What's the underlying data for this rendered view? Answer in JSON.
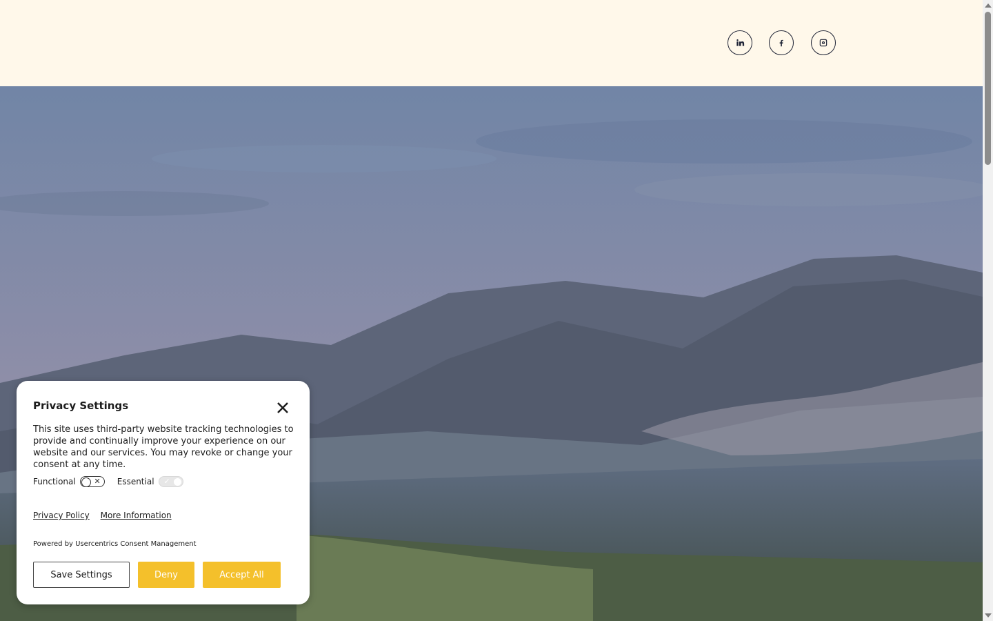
{
  "header": {
    "social": [
      {
        "name": "LinkedIn",
        "icon": "linkedin-icon"
      },
      {
        "name": "Facebook",
        "icon": "facebook-icon"
      },
      {
        "name": "Instagram",
        "icon": "instagram-icon"
      }
    ]
  },
  "consent": {
    "title": "Privacy Settings",
    "description": "This site uses third-party website tracking technologies to provide and continually improve your experience on our website and our services. You may revoke or change your consent at any time.",
    "toggles": [
      {
        "label": "Functional",
        "state": "off"
      },
      {
        "label": "Essential",
        "state": "on-disabled"
      }
    ],
    "links": {
      "privacy": "Privacy Policy",
      "more": "More Information"
    },
    "powered_by": "Powered by Usercentrics Consent Management",
    "buttons": {
      "save": "Save Settings",
      "deny": "Deny",
      "accept": "Accept All"
    }
  },
  "colors": {
    "accent": "#f4c02b",
    "header_bg": "#fff8ea",
    "icon": "#1f2436"
  }
}
